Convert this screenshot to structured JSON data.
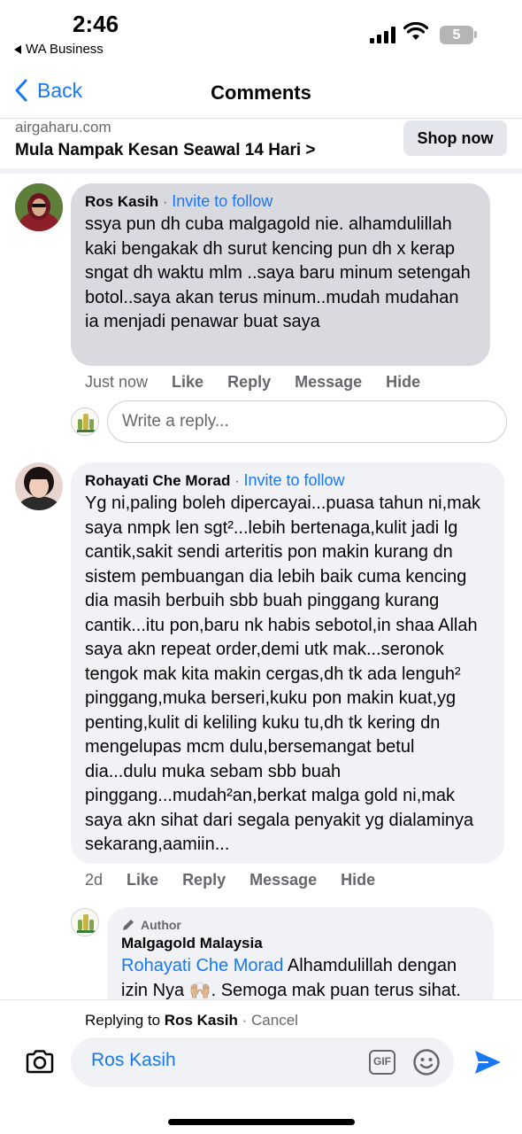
{
  "status_bar": {
    "time": "2:46",
    "back_app": "WA Business",
    "battery": "5"
  },
  "nav": {
    "back_label": "Back",
    "title": "Comments"
  },
  "ad": {
    "domain": "airgaharu.com",
    "headline": "Mula Nampak Kesan Seawal 14 Hari >",
    "shop_label": "Shop now"
  },
  "comments": [
    {
      "name": "Ros Kasih",
      "dot": " · ",
      "follow": "Invite to follow",
      "text": "ssya pun dh cuba malgagold nie. alhamdulillah kaki bengakak dh surut kencing pun dh x kerap sngat dh waktu mlm ..saya baru minum setengah botol..saya akan terus minum..mudah mudahan ia menjadi penawar buat saya",
      "time": "Just now",
      "actions": [
        "Like",
        "Reply",
        "Message",
        "Hide"
      ]
    },
    {
      "name": "Rohayati Che Morad",
      "dot": " · ",
      "follow": "Invite to follow",
      "text": "Yg ni,paling boleh dipercayai...puasa tahun ni,mak saya nmpk len sgt²...lebih bertenaga,kulit jadi lg cantik,sakit sendi arteritis pon makin kurang dn sistem pembuangan dia lebih baik cuma kencing dia masih berbuih sbb buah pinggang kurang cantik...itu pon,baru nk habis sebotol,in shaa Allah saya akn repeat order,demi utk mak...seronok tengok mak kita makin cergas,dh tk ada lenguh² pinggang,muka berseri,kuku pon makin kuat,yg penting,kulit di keliling kuku tu,dh tk kering dn mengelupas mcm dulu,bersemangat betul dia...dulu muka sebam sbb buah pinggang...mudah²an,berkat malga gold ni,mak saya akn sihat dari segala penyakit yg dialaminya sekarang,aamiin...",
      "time": "2d",
      "actions": [
        "Like",
        "Reply",
        "Message",
        "Hide"
      ]
    }
  ],
  "reply_box": {
    "placeholder": "Write a reply..."
  },
  "author_reply": {
    "tag": "Author",
    "name": "Malgagold Malaysia",
    "mention": "Rohayati Che Morad",
    "text": " Alhamdulillah dengan izin Nya 🙌🏼. Semoga mak puan terus sihat."
  },
  "composer": {
    "replying_prefix": "Replying to ",
    "replying_name": "Ros Kasih",
    "cancel": " · Cancel",
    "input_value": "Ros Kasih",
    "gif_label": "GIF"
  },
  "colors": {
    "accent": "#1877f2",
    "bubble_gray": "#d8dadf",
    "bubble_light": "#f0f2f5"
  }
}
